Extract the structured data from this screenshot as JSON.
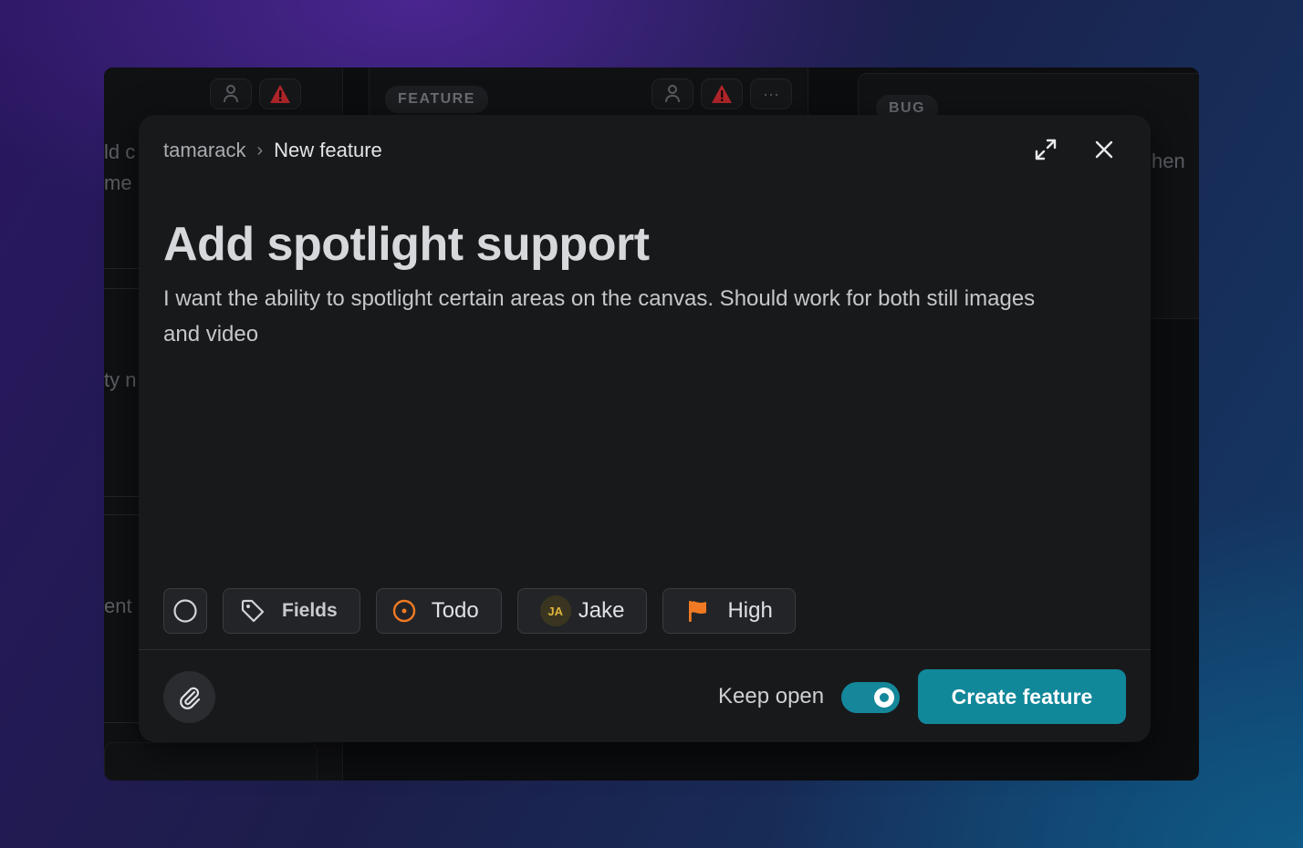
{
  "background": {
    "tags": [
      "FEATURE",
      "BUG"
    ],
    "text_fragments": [
      "ld c",
      "me",
      "ty n",
      "ent",
      "hen"
    ]
  },
  "modal": {
    "breadcrumb": {
      "project": "tamarack",
      "separator": "›",
      "current": "New feature"
    },
    "header_icons": {
      "expand": "expand-icon",
      "close": "close-icon"
    },
    "title": "Add spotlight support",
    "description": "I want the ability to spotlight certain areas on the canvas. Should work for both still images and video",
    "properties": {
      "fields_label": "Fields",
      "status_label": "Todo",
      "status_color": "#f07a23",
      "assignee_initials": "JA",
      "assignee_name": "Jake",
      "priority_label": "High",
      "priority_color": "#f07a23"
    },
    "footer": {
      "keep_open_label": "Keep open",
      "keep_open_enabled": true,
      "create_label": "Create feature",
      "accent_color": "#11879a"
    }
  }
}
